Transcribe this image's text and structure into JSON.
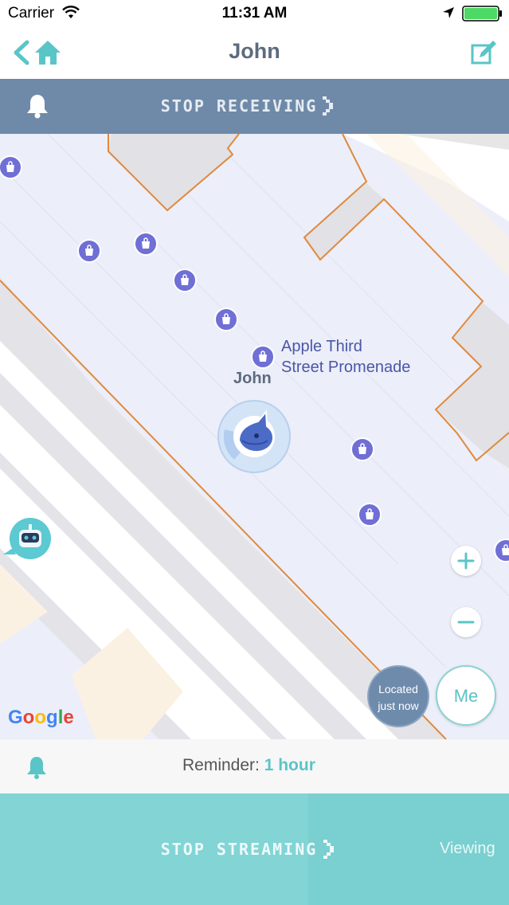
{
  "status_bar": {
    "carrier": "Carrier",
    "time": "11:31 AM"
  },
  "nav": {
    "title": "John"
  },
  "receiving_banner": {
    "label": "STOP RECEIVING"
  },
  "map": {
    "place_label_line1": "Apple Third",
    "place_label_line2": "Street Promenade",
    "person_label": "John",
    "located_line1": "Located",
    "located_line2": "just now",
    "me_label": "Me",
    "attribution": "Google"
  },
  "reminder": {
    "label": "Reminder:",
    "value": "1 hour"
  },
  "streaming_bar": {
    "label": "STOP STREAMING",
    "viewing": "Viewing"
  },
  "colors": {
    "accent": "#5ac5c6",
    "banner": "#6f8aa8",
    "poi": "#6f6fd6"
  }
}
